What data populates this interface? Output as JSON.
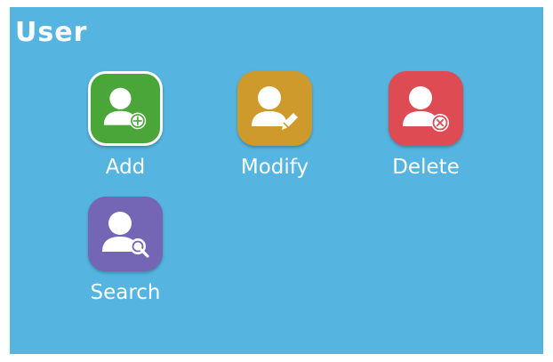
{
  "screen": {
    "title": "User",
    "background": "#55b5e0"
  },
  "menu": {
    "items": [
      {
        "label": "Add",
        "icon": "user-add-icon",
        "color": "#4ba63a",
        "selected": true
      },
      {
        "label": "Modify",
        "icon": "user-modify-icon",
        "color": "#cd9a2b",
        "selected": false
      },
      {
        "label": "Delete",
        "icon": "user-delete-icon",
        "color": "#de4b53",
        "selected": false
      },
      {
        "label": "Search",
        "icon": "user-search-icon",
        "color": "#7466b4",
        "selected": false
      }
    ]
  }
}
